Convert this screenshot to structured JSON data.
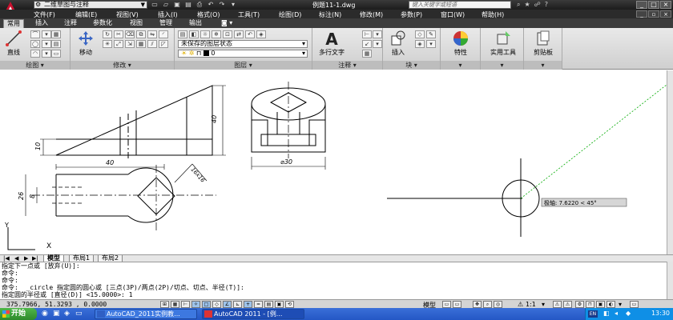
{
  "titlebar": {
    "workspace": "二维草图与注释",
    "document_title": "例题11-1.dwg",
    "search_placeholder": "键入关键字或短语"
  },
  "menu": [
    "文件(F)",
    "编辑(E)",
    "视图(V)",
    "插入(I)",
    "格式(O)",
    "工具(T)",
    "绘图(D)",
    "标注(N)",
    "修改(M)",
    "参数(P)",
    "窗口(W)",
    "帮助(H)"
  ],
  "ribbon_tabs": [
    "常用",
    "插入",
    "注释",
    "参数化",
    "视图",
    "管理",
    "输出"
  ],
  "ribbon": {
    "draw": {
      "title": "绘图",
      "line_label": "直线"
    },
    "modify": {
      "title": "修改",
      "move_label": "移动"
    },
    "layers": {
      "title": "图层",
      "layer_state": "未保存的图层状态",
      "current_layer": "0"
    },
    "annotation": {
      "title": "注释",
      "mtext_label": "多行文字"
    },
    "block": {
      "title": "块",
      "insert_label": "插入"
    },
    "properties": {
      "label": "特性"
    },
    "utilities": {
      "label": "实用工具"
    },
    "clipboard": {
      "label": "剪贴板"
    }
  },
  "drawing": {
    "dim_40_top": "40",
    "dim_40_vertical": "40",
    "dim_10": "10",
    "dim_26": "26",
    "dim_8": "8",
    "dim_phi30": "⌀30",
    "dim_square": "16x16",
    "polar_tooltip": "极轴: 7.6220 < 45°",
    "ucs_x": "X",
    "ucs_y": "Y"
  },
  "layout_tabs": [
    "模型",
    "布局1",
    "布局2"
  ],
  "command_lines": [
    "指定下一点或 [放弃(U)]:",
    "命令:",
    "命令:",
    "命令:  _circle 指定圆的圆心或 [三点(3P)/两点(2P)/切点、切点、半径(T)]:",
    "指定圆的半径或 [直径(D)] <15.0000>: 1"
  ],
  "statusbar": {
    "coords": "375.7966, 51.3293 , 0.0000",
    "model_label": "模型",
    "scale": "1:1"
  },
  "taskbar": {
    "start": "开始",
    "items": [
      "AutoCAD_2011实例教...",
      "AutoCAD 2011 - [例..."
    ],
    "lang": "EN",
    "clock": "13:30"
  }
}
